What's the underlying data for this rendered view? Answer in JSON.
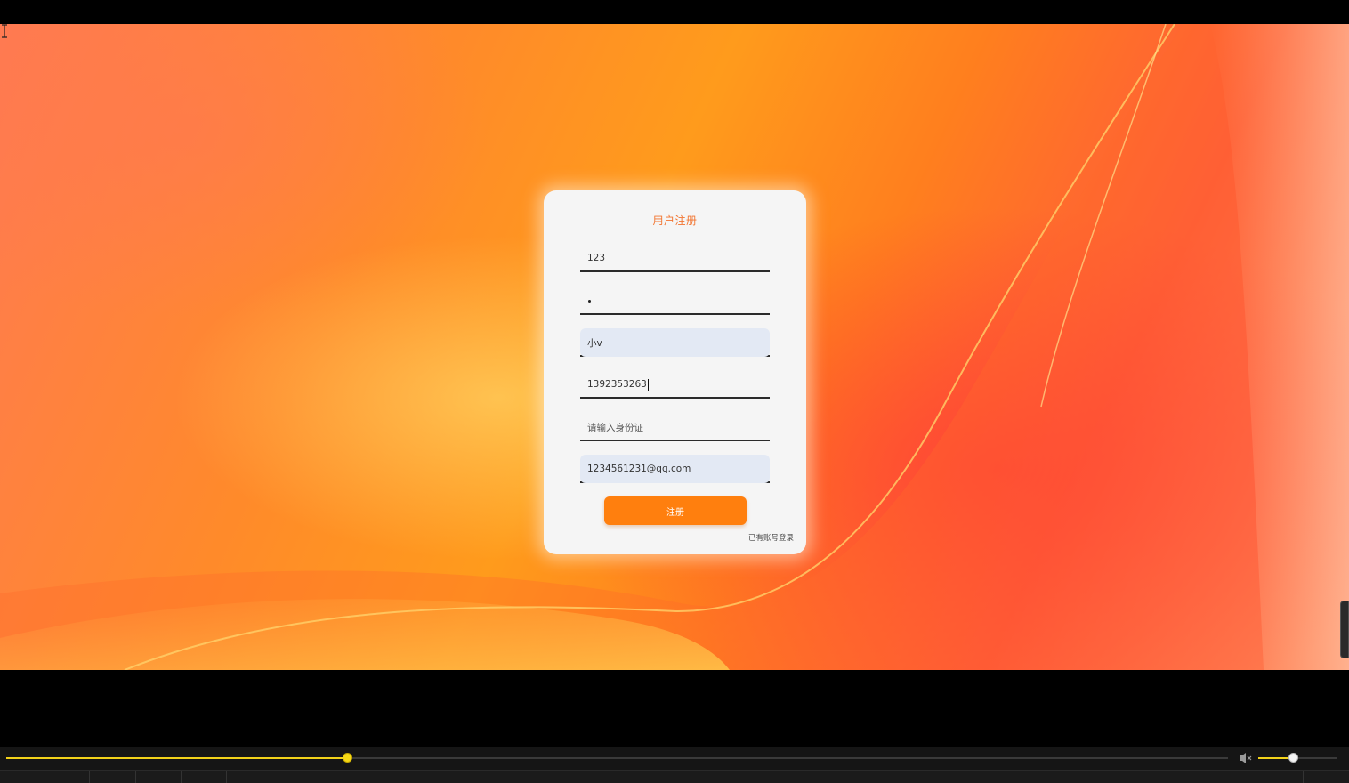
{
  "form": {
    "title": "用户注册",
    "fields": [
      {
        "name": "username",
        "value": "123"
      },
      {
        "name": "password",
        "value": ""
      },
      {
        "name": "nickname",
        "value": "小v"
      },
      {
        "name": "phone",
        "value": "1392353263"
      },
      {
        "name": "id-card",
        "placeholder": "请输入身份证"
      },
      {
        "name": "email",
        "value": "1234561231@qq.com"
      }
    ],
    "submit_label": "注册",
    "login_link": "已有账号登录"
  },
  "player": {
    "progress_fraction": 0.28,
    "volume_fraction": 0.45,
    "accent_color": "#f2d21a"
  },
  "colors": {
    "title": "#f2742f",
    "button": "#ff7f0e",
    "filled_field_bg": "#e3e9f4"
  },
  "icons": [
    "volume-icon",
    "text-cursor-icon"
  ]
}
